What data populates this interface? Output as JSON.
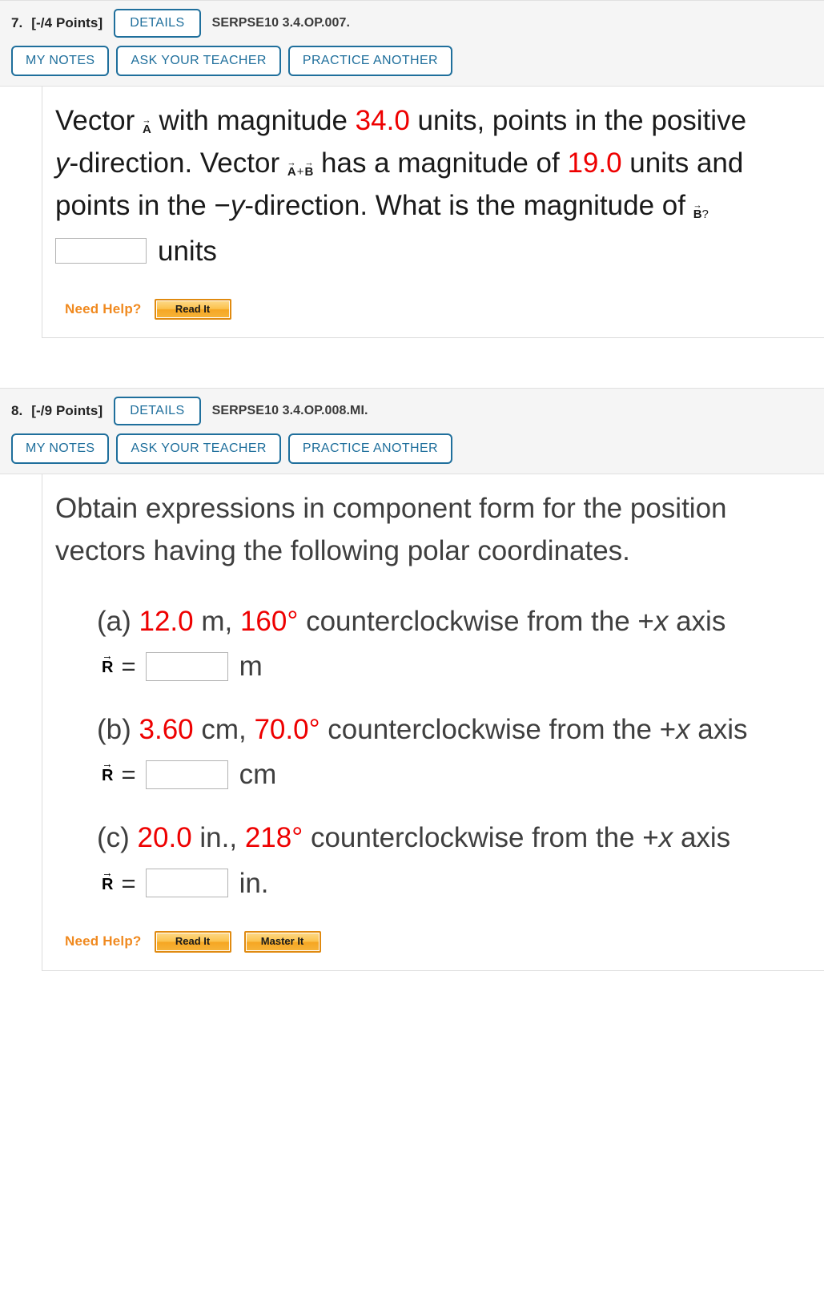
{
  "problems": [
    {
      "number": "7.",
      "points": "[-/4 Points]",
      "details_label": "DETAILS",
      "code": "SERPSE10 3.4.OP.007.",
      "buttons": {
        "my_notes": "MY NOTES",
        "ask_your_teacher": "ASK YOUR TEACHER",
        "practice_another": "PRACTICE ANOTHER"
      },
      "stem": {
        "t1": "Vector ",
        "vec_a": "A",
        "t2": " with magnitude ",
        "mag1": "34.0",
        "t3": " units, points in the positive ",
        "axis1": "y",
        "t4": "-direction. Vector ",
        "vec_ab_a": "A",
        "vec_ab_plus": "+",
        "vec_ab_b": "B",
        "t5": " has a magnitude of ",
        "mag2": "19.0",
        "t6": " units and points in the −",
        "axis2": "y",
        "t7": "-direction. What is the magnitude of ",
        "vec_b": "B",
        "vec_b_q": "?"
      },
      "answer": {
        "value": "",
        "placeholder": "",
        "unit": "units"
      },
      "need_help": {
        "label": "Need Help?",
        "buttons": [
          "Read It"
        ]
      }
    },
    {
      "number": "8.",
      "points": "[-/9 Points]",
      "details_label": "DETAILS",
      "code": "SERPSE10 3.4.OP.008.MI.",
      "buttons": {
        "my_notes": "MY NOTES",
        "ask_your_teacher": "ASK YOUR TEACHER",
        "practice_another": "PRACTICE ANOTHER"
      },
      "stem": {
        "text": "Obtain expressions in component form for the position vectors having the following polar coordinates."
      },
      "parts": [
        {
          "label": "(a) ",
          "magnitude": "12.0",
          "mag_unit": " m, ",
          "angle": "160°",
          "tail": " counterclockwise from the +",
          "axis": "x",
          "tail2": " axis",
          "vector_symbol": "R",
          "equals": "=",
          "value": "",
          "unit": "m"
        },
        {
          "label": "(b) ",
          "magnitude": "3.60",
          "mag_unit": " cm, ",
          "angle": "70.0°",
          "tail": " counterclockwise from the +",
          "axis": "x",
          "tail2": " axis",
          "vector_symbol": "R",
          "equals": "=",
          "value": "",
          "unit": "cm"
        },
        {
          "label": "(c) ",
          "magnitude": "20.0",
          "mag_unit": " in., ",
          "angle": "218°",
          "tail": " counterclockwise from the +",
          "axis": "x",
          "tail2": " axis",
          "vector_symbol": "R",
          "equals": "=",
          "value": "",
          "unit": "in."
        }
      ],
      "need_help": {
        "label": "Need Help?",
        "buttons": [
          "Read It",
          "Master It"
        ]
      }
    }
  ],
  "colors": {
    "accent_blue": "#1f6f9c",
    "highlight_red": "#ee0000",
    "help_orange": "#f08a20",
    "header_bg": "#f5f5f5"
  }
}
